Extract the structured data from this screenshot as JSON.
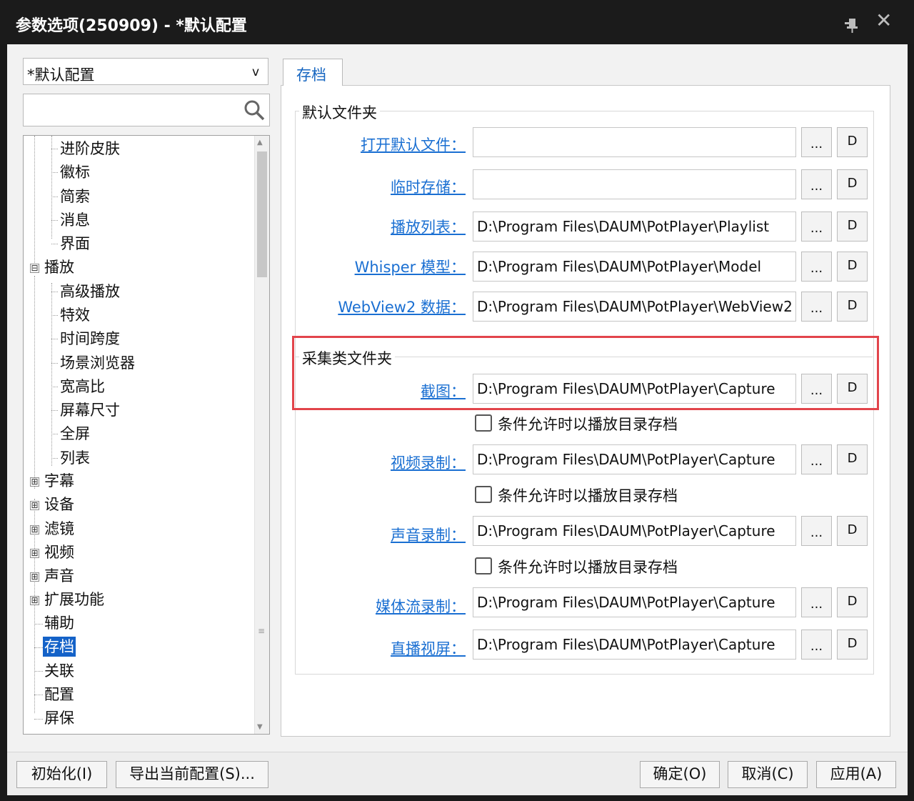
{
  "window": {
    "title": "参数选项(250909) - *默认配置"
  },
  "sidebar": {
    "profile": "*默认配置",
    "profile_caret": "v",
    "search_placeholder": "",
    "tree": {
      "level2_a": [
        "进阶皮肤",
        "徽标",
        "简索",
        "消息",
        "界面"
      ],
      "playback": "播放",
      "playback_children": [
        "高级播放",
        "特效",
        "时间跨度",
        "场景浏览器",
        "宽高比",
        "屏幕尺寸",
        "全屏",
        "列表"
      ],
      "collapsed": [
        "字幕",
        "设备",
        "滤镜",
        "视频",
        "声音",
        "扩展功能"
      ],
      "leaves": [
        "辅助",
        "存档",
        "关联",
        "配置",
        "屏保"
      ],
      "expand_sign": "⊞",
      "collapse_sign": "⊟"
    }
  },
  "tab": {
    "label": "存档"
  },
  "default_folders": {
    "title": "默认文件夹",
    "rows": [
      {
        "label": "打开默认文件：",
        "value": ""
      },
      {
        "label": "临时存储：",
        "value": ""
      },
      {
        "label": "播放列表：",
        "value": "D:\\Program Files\\DAUM\\PotPlayer\\Playlist"
      },
      {
        "label": "Whisper 模型：",
        "value": "D:\\Program Files\\DAUM\\PotPlayer\\Model"
      },
      {
        "label": "WebView2 数据：",
        "value": "D:\\Program Files\\DAUM\\PotPlayer\\WebView2"
      }
    ]
  },
  "capture_folders": {
    "title": "采集类文件夹",
    "rows": [
      {
        "label": "截图：",
        "value": "D:\\Program Files\\DAUM\\PotPlayer\\Capture"
      },
      {
        "label": "视频录制：",
        "value": "D:\\Program Files\\DAUM\\PotPlayer\\Capture"
      },
      {
        "label": "声音录制：",
        "value": "D:\\Program Files\\DAUM\\PotPlayer\\Capture"
      },
      {
        "label": "媒体流录制：",
        "value": "D:\\Program Files\\DAUM\\PotPlayer\\Capture"
      },
      {
        "label": "直播视屏：",
        "value": "D:\\Program Files\\DAUM\\PotPlayer\\Capture"
      }
    ],
    "checkbox_label": "条件允许时以播放目录存档"
  },
  "row_buttons": {
    "browse": "...",
    "default": "D"
  },
  "footer": {
    "reset": "初始化(I)",
    "export": "导出当前配置(S)...",
    "ok": "确定(O)",
    "cancel": "取消(C)",
    "apply": "应用(A)"
  },
  "colors": {
    "accent": "#1462c8",
    "link": "#1a6fd2",
    "highlight": "#e2444b",
    "titlebar": "#1b1b1b"
  }
}
